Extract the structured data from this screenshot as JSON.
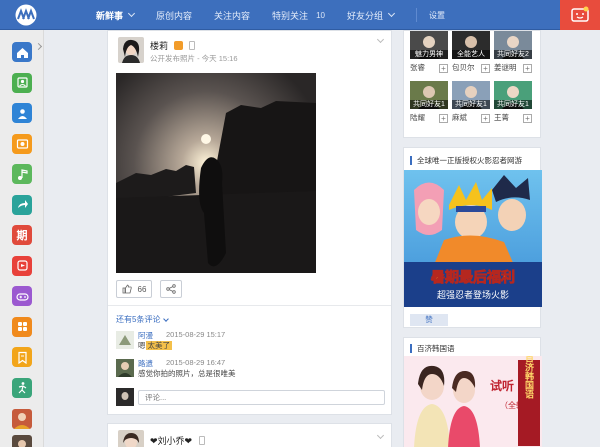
{
  "nav": {
    "items": [
      {
        "label": "新鲜事",
        "active": true,
        "has_dropdown": true
      },
      {
        "label": "原创内容"
      },
      {
        "label": "关注内容"
      },
      {
        "label": "特别关注",
        "count": "10"
      },
      {
        "label": "好友分组",
        "has_dropdown": true
      },
      {
        "label": "设置"
      }
    ]
  },
  "colors": {
    "topbar": "#3d6fbd",
    "accent": "#3b6ec0",
    "notify": "#e84c3d"
  },
  "rail": {
    "buttons": [
      {
        "icon": "home-icon",
        "color": "#3a78c9"
      },
      {
        "icon": "profile-icon",
        "color": "#4caf50"
      },
      {
        "icon": "friends-icon",
        "color": "#2f84d6"
      },
      {
        "icon": "photo-icon",
        "color": "#f59a1c"
      },
      {
        "icon": "music-icon",
        "color": "#5cb85c"
      },
      {
        "icon": "share-icon",
        "color": "#2aa39a"
      },
      {
        "icon": "period-icon",
        "color": "#e04a3b",
        "glyph": "期"
      },
      {
        "icon": "game-red-icon",
        "color": "#e8413a"
      },
      {
        "icon": "gamepad-icon",
        "color": "#9b59d0"
      },
      {
        "icon": "apps-icon",
        "color": "#f08a1c"
      },
      {
        "icon": "bookmark-icon",
        "color": "#f2a51a"
      },
      {
        "icon": "fitness-icon",
        "color": "#3aa57a"
      }
    ]
  },
  "feed": {
    "post": {
      "username": "楼莉",
      "meta": "公开发布照片 - 今天 15:16",
      "likes": "66",
      "more_comments": "还有5条评论",
      "comments": [
        {
          "name": "阿漫",
          "time": "2015-08-29 15:17",
          "text_prefix": "嗯",
          "text_highlight": "太美了"
        },
        {
          "name": "路遗",
          "time": "2015-08-29 16:47",
          "text": "感觉你拍的照片，总是很唯美"
        }
      ],
      "comment_placeholder": "评论..."
    },
    "next_post": {
      "username": "❤刘小乔❤"
    }
  },
  "friends": {
    "row1": [
      {
        "name": "张睿",
        "label": "魅力男神"
      },
      {
        "name": "包贝尔",
        "label": "全能艺人"
      },
      {
        "name": "姜谜明",
        "label": "共同好友2"
      }
    ],
    "row2": [
      {
        "name": "陆耀",
        "label": "共同好友1"
      },
      {
        "name": "麻斌",
        "label": "共同好友1"
      },
      {
        "name": "王菁",
        "label": "共同好友1"
      }
    ]
  },
  "ads": {
    "naruto": {
      "title": "全球唯一正版授权火影忍者网游",
      "banner_main": "暑期最后福利",
      "banner_sub": "超强忍者登场火影",
      "like_label": "赞"
    },
    "korean": {
      "title": "百济韩国语",
      "banner_text1": "试听",
      "banner_text2": "（全韩精外",
      "banner_text3": "百济韩国语"
    }
  }
}
